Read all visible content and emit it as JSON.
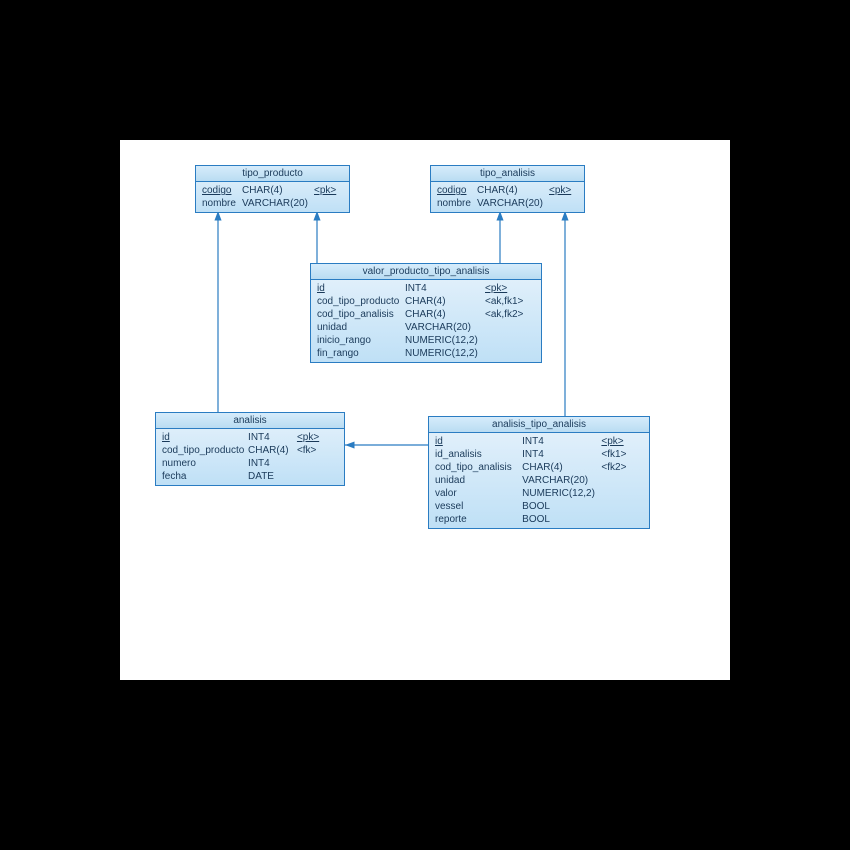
{
  "diagram": {
    "type": "entity-relationship",
    "entities": {
      "tipo_producto": {
        "title": "tipo_producto",
        "rows": [
          {
            "name": "codigo",
            "type": "CHAR(4)",
            "key": "<pk>",
            "underline_name": true,
            "underline_key": true
          },
          {
            "name": "nombre",
            "type": "VARCHAR(20)",
            "key": ""
          }
        ]
      },
      "tipo_analisis": {
        "title": "tipo_analisis",
        "rows": [
          {
            "name": "codigo",
            "type": "CHAR(4)",
            "key": "<pk>",
            "underline_name": true,
            "underline_key": true
          },
          {
            "name": "nombre",
            "type": "VARCHAR(20)",
            "key": ""
          }
        ]
      },
      "valor_producto_tipo_analisis": {
        "title": "valor_producto_tipo_analisis",
        "rows": [
          {
            "name": "id",
            "type": "INT4",
            "key": "<pk>",
            "underline_name": true,
            "underline_key": true
          },
          {
            "name": "cod_tipo_producto",
            "type": "CHAR(4)",
            "key": "<ak,fk1>"
          },
          {
            "name": "cod_tipo_analisis",
            "type": "CHAR(4)",
            "key": "<ak,fk2>"
          },
          {
            "name": "unidad",
            "type": "VARCHAR(20)",
            "key": ""
          },
          {
            "name": "inicio_rango",
            "type": "NUMERIC(12,2)",
            "key": ""
          },
          {
            "name": "fin_rango",
            "type": "NUMERIC(12,2)",
            "key": ""
          }
        ]
      },
      "analisis": {
        "title": "analisis",
        "rows": [
          {
            "name": "id",
            "type": "INT4",
            "key": "<pk>",
            "underline_name": true,
            "underline_key": true
          },
          {
            "name": "cod_tipo_producto",
            "type": "CHAR(4)",
            "key": "<fk>"
          },
          {
            "name": "numero",
            "type": "INT4",
            "key": ""
          },
          {
            "name": "fecha",
            "type": "DATE",
            "key": ""
          }
        ]
      },
      "analisis_tipo_analisis": {
        "title": "analisis_tipo_analisis",
        "rows": [
          {
            "name": "id",
            "type": "INT4",
            "key": "<pk>",
            "underline_name": true,
            "underline_key": true
          },
          {
            "name": "id_analisis",
            "type": "INT4",
            "key": "<fk1>"
          },
          {
            "name": "cod_tipo_analisis",
            "type": "CHAR(4)",
            "key": "<fk2>"
          },
          {
            "name": "unidad",
            "type": "VARCHAR(20)",
            "key": ""
          },
          {
            "name": "valor",
            "type": "NUMERIC(12,2)",
            "key": ""
          },
          {
            "name": "vessel",
            "type": "BOOL",
            "key": ""
          },
          {
            "name": "reporte",
            "type": "BOOL",
            "key": ""
          }
        ]
      }
    },
    "relationships": [
      {
        "from": "valor_producto_tipo_analisis",
        "to": "tipo_producto"
      },
      {
        "from": "valor_producto_tipo_analisis",
        "to": "tipo_analisis"
      },
      {
        "from": "analisis",
        "to": "tipo_producto"
      },
      {
        "from": "analisis_tipo_analisis",
        "to": "analisis"
      },
      {
        "from": "analisis_tipo_analisis",
        "to": "tipo_analisis"
      }
    ]
  }
}
